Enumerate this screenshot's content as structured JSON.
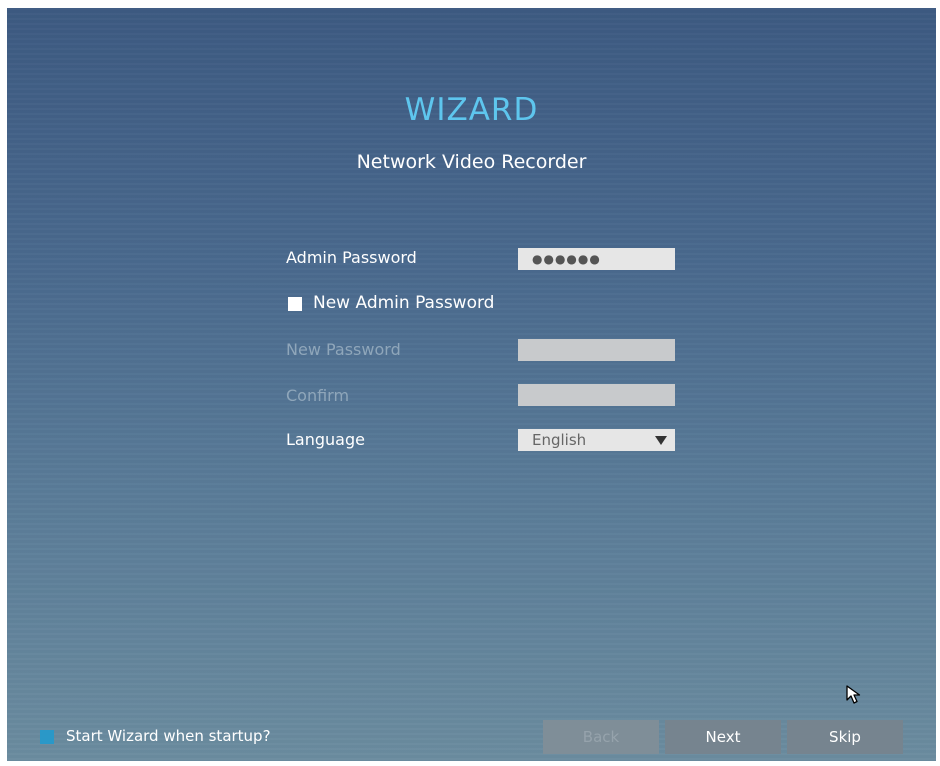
{
  "header": {
    "title": "WIZARD",
    "subtitle": "Network Video Recorder"
  },
  "form": {
    "admin_password_label": "Admin Password",
    "admin_password_value": "●●●●●●",
    "new_admin_password_label": "New Admin Password",
    "new_admin_password_checked": false,
    "new_password_label": "New Password",
    "confirm_label": "Confirm",
    "language_label": "Language",
    "language_value": "English"
  },
  "footer": {
    "startup_label": "Start Wizard when startup?",
    "back_label": "Back",
    "next_label": "Next",
    "skip_label": "Skip"
  },
  "colors": {
    "title_accent": "#5ec6ee",
    "checkbox_accent": "#2a98c8"
  },
  "icons": {
    "cursor": "mouse-pointer-icon",
    "dropdown": "dropdown-arrow-icon"
  }
}
